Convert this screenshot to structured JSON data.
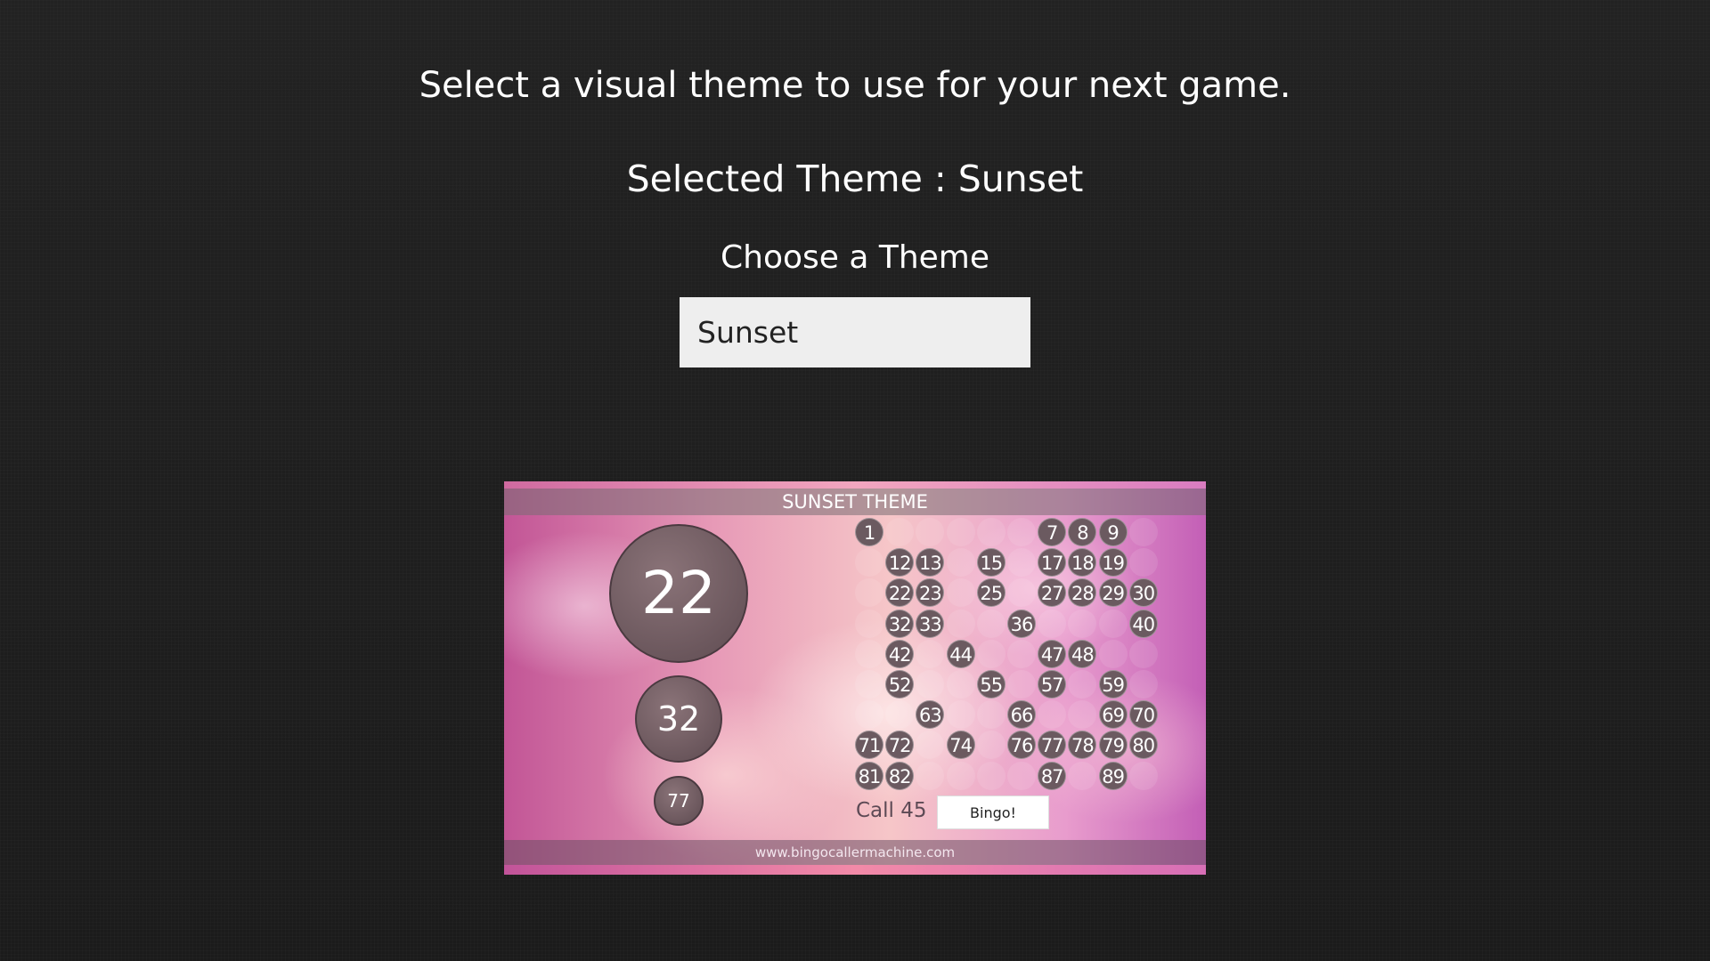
{
  "intro": "Select a visual theme to use for your next game.",
  "selected_theme": {
    "label": "Selected Theme : Sunset"
  },
  "chooser": {
    "label": "Choose a Theme",
    "value": "Sunset"
  },
  "preview": {
    "title": "SUNSET THEME",
    "current_ball": "22",
    "previous_balls": [
      "32",
      "77"
    ],
    "called_numbers": [
      1,
      7,
      8,
      9,
      12,
      13,
      15,
      17,
      18,
      19,
      22,
      23,
      25,
      27,
      28,
      29,
      30,
      32,
      33,
      36,
      40,
      42,
      44,
      47,
      48,
      52,
      55,
      57,
      59,
      63,
      66,
      69,
      70,
      71,
      72,
      74,
      76,
      77,
      78,
      79,
      80,
      81,
      82,
      87,
      89
    ],
    "call_label": "Call 45",
    "bingo_button": "Bingo!",
    "footer": "www.bingocallermachine.com",
    "colors": {
      "called_ball": "#6b5a60",
      "page_background": "#1d1d1d",
      "select_background": "#eeeeee"
    }
  }
}
